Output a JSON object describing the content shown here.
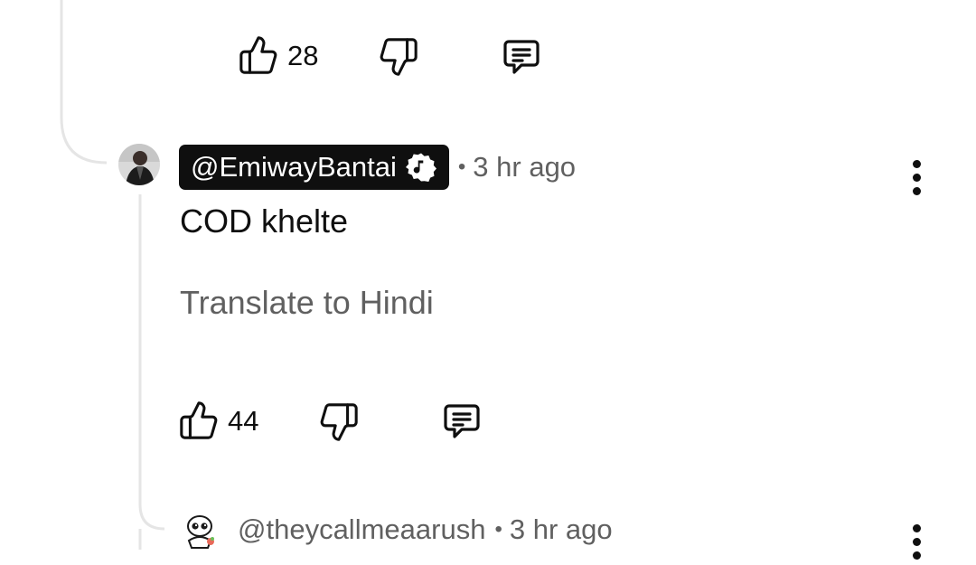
{
  "previous_comment": {
    "like_count": "28"
  },
  "reply": {
    "handle": "@EmiwayBantai",
    "badge_icon": "music-note-verified-badge",
    "time": "3 hr ago",
    "text": "COD khelte",
    "translate_label": "Translate to Hindi",
    "like_count": "44"
  },
  "next_reply": {
    "handle": "@theycallmeaarush",
    "time": "3 hr ago"
  },
  "icons": {
    "like": "thumbs-up-icon",
    "dislike": "thumbs-down-icon",
    "reply": "reply-comment-icon",
    "menu": "more-vert-icon"
  },
  "colors": {
    "text": "#0f0f0f",
    "secondary": "#606060",
    "thread_line": "#e5e5e5",
    "chip_bg": "#0f0f0f"
  },
  "separator": "•"
}
